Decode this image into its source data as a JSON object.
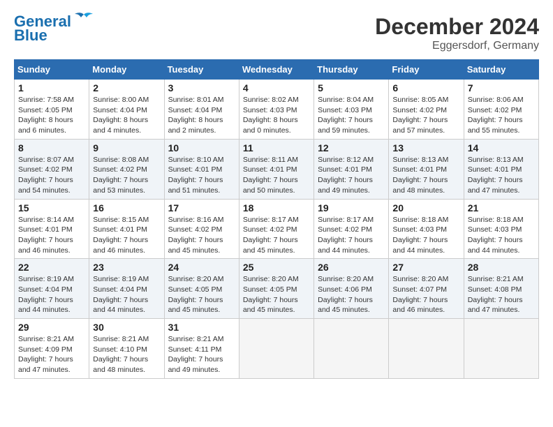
{
  "header": {
    "logo_line1": "General",
    "logo_line2": "Blue",
    "month_year": "December 2024",
    "location": "Eggersdorf, Germany"
  },
  "weekdays": [
    "Sunday",
    "Monday",
    "Tuesday",
    "Wednesday",
    "Thursday",
    "Friday",
    "Saturday"
  ],
  "weeks": [
    [
      {
        "day": "1",
        "sunrise": "7:58 AM",
        "sunset": "4:05 PM",
        "daylight": "8 hours and 6 minutes."
      },
      {
        "day": "2",
        "sunrise": "8:00 AM",
        "sunset": "4:04 PM",
        "daylight": "8 hours and 4 minutes."
      },
      {
        "day": "3",
        "sunrise": "8:01 AM",
        "sunset": "4:04 PM",
        "daylight": "8 hours and 2 minutes."
      },
      {
        "day": "4",
        "sunrise": "8:02 AM",
        "sunset": "4:03 PM",
        "daylight": "8 hours and 0 minutes."
      },
      {
        "day": "5",
        "sunrise": "8:04 AM",
        "sunset": "4:03 PM",
        "daylight": "7 hours and 59 minutes."
      },
      {
        "day": "6",
        "sunrise": "8:05 AM",
        "sunset": "4:02 PM",
        "daylight": "7 hours and 57 minutes."
      },
      {
        "day": "7",
        "sunrise": "8:06 AM",
        "sunset": "4:02 PM",
        "daylight": "7 hours and 55 minutes."
      }
    ],
    [
      {
        "day": "8",
        "sunrise": "8:07 AM",
        "sunset": "4:02 PM",
        "daylight": "7 hours and 54 minutes."
      },
      {
        "day": "9",
        "sunrise": "8:08 AM",
        "sunset": "4:02 PM",
        "daylight": "7 hours and 53 minutes."
      },
      {
        "day": "10",
        "sunrise": "8:10 AM",
        "sunset": "4:01 PM",
        "daylight": "7 hours and 51 minutes."
      },
      {
        "day": "11",
        "sunrise": "8:11 AM",
        "sunset": "4:01 PM",
        "daylight": "7 hours and 50 minutes."
      },
      {
        "day": "12",
        "sunrise": "8:12 AM",
        "sunset": "4:01 PM",
        "daylight": "7 hours and 49 minutes."
      },
      {
        "day": "13",
        "sunrise": "8:13 AM",
        "sunset": "4:01 PM",
        "daylight": "7 hours and 48 minutes."
      },
      {
        "day": "14",
        "sunrise": "8:13 AM",
        "sunset": "4:01 PM",
        "daylight": "7 hours and 47 minutes."
      }
    ],
    [
      {
        "day": "15",
        "sunrise": "8:14 AM",
        "sunset": "4:01 PM",
        "daylight": "7 hours and 46 minutes."
      },
      {
        "day": "16",
        "sunrise": "8:15 AM",
        "sunset": "4:01 PM",
        "daylight": "7 hours and 46 minutes."
      },
      {
        "day": "17",
        "sunrise": "8:16 AM",
        "sunset": "4:02 PM",
        "daylight": "7 hours and 45 minutes."
      },
      {
        "day": "18",
        "sunrise": "8:17 AM",
        "sunset": "4:02 PM",
        "daylight": "7 hours and 45 minutes."
      },
      {
        "day": "19",
        "sunrise": "8:17 AM",
        "sunset": "4:02 PM",
        "daylight": "7 hours and 44 minutes."
      },
      {
        "day": "20",
        "sunrise": "8:18 AM",
        "sunset": "4:03 PM",
        "daylight": "7 hours and 44 minutes."
      },
      {
        "day": "21",
        "sunrise": "8:18 AM",
        "sunset": "4:03 PM",
        "daylight": "7 hours and 44 minutes."
      }
    ],
    [
      {
        "day": "22",
        "sunrise": "8:19 AM",
        "sunset": "4:04 PM",
        "daylight": "7 hours and 44 minutes."
      },
      {
        "day": "23",
        "sunrise": "8:19 AM",
        "sunset": "4:04 PM",
        "daylight": "7 hours and 44 minutes."
      },
      {
        "day": "24",
        "sunrise": "8:20 AM",
        "sunset": "4:05 PM",
        "daylight": "7 hours and 45 minutes."
      },
      {
        "day": "25",
        "sunrise": "8:20 AM",
        "sunset": "4:05 PM",
        "daylight": "7 hours and 45 minutes."
      },
      {
        "day": "26",
        "sunrise": "8:20 AM",
        "sunset": "4:06 PM",
        "daylight": "7 hours and 45 minutes."
      },
      {
        "day": "27",
        "sunrise": "8:20 AM",
        "sunset": "4:07 PM",
        "daylight": "7 hours and 46 minutes."
      },
      {
        "day": "28",
        "sunrise": "8:21 AM",
        "sunset": "4:08 PM",
        "daylight": "7 hours and 47 minutes."
      }
    ],
    [
      {
        "day": "29",
        "sunrise": "8:21 AM",
        "sunset": "4:09 PM",
        "daylight": "7 hours and 47 minutes."
      },
      {
        "day": "30",
        "sunrise": "8:21 AM",
        "sunset": "4:10 PM",
        "daylight": "7 hours and 48 minutes."
      },
      {
        "day": "31",
        "sunrise": "8:21 AM",
        "sunset": "4:11 PM",
        "daylight": "7 hours and 49 minutes."
      },
      null,
      null,
      null,
      null
    ]
  ],
  "labels": {
    "sunrise": "Sunrise:",
    "sunset": "Sunset:",
    "daylight": "Daylight:"
  }
}
